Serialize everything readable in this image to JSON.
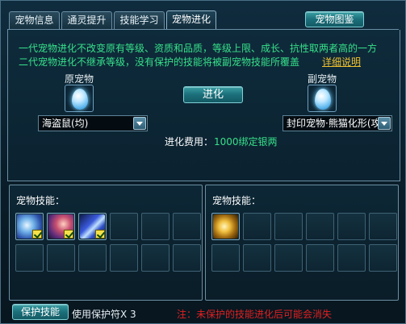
{
  "tabs": [
    {
      "label": "宠物信息",
      "active": false
    },
    {
      "label": "通灵提升",
      "active": false
    },
    {
      "label": "技能学习",
      "active": false
    },
    {
      "label": "宠物进化",
      "active": true
    }
  ],
  "pet_atlas_button": "宠物图鉴",
  "info": {
    "line1": "一代宠物进化不改变原有等级、资质和品质，等级上限、成长、抗性取两者高的一方",
    "line2": "二代宠物进化不继承等级，没有保护的技能将被副宠物技能所覆盖",
    "detail_link": "详细说明"
  },
  "original_pet": {
    "label": "原宠物",
    "icon": "blue-egg-icon",
    "selected": "海盗鼠(均)"
  },
  "secondary_pet": {
    "label": "副宠物",
    "icon": "blue-egg-icon",
    "selected": "封印宠物·熊猫化形(攻)"
  },
  "evolve_button": "进化",
  "cost": {
    "label": "进化费用：",
    "value": "1000绑定银两"
  },
  "left_skills": {
    "title": "宠物技能：",
    "slots": [
      {
        "icon": "wind-swirl-skill-icon",
        "protected": true
      },
      {
        "icon": "fire-dragon-skill-icon",
        "protected": true
      },
      {
        "icon": "blue-slash-skill-icon",
        "protected": true
      },
      {
        "icon": "",
        "protected": false
      },
      {
        "icon": "",
        "protected": false
      },
      {
        "icon": "",
        "protected": false
      },
      {
        "icon": "",
        "protected": false
      },
      {
        "icon": "",
        "protected": false
      },
      {
        "icon": "",
        "protected": false
      },
      {
        "icon": "",
        "protected": false
      },
      {
        "icon": "",
        "protected": false
      },
      {
        "icon": "",
        "protected": false
      }
    ]
  },
  "right_skills": {
    "title": "宠物技能：",
    "slots": [
      {
        "icon": "golden-burst-skill-icon",
        "protected": false
      },
      {
        "icon": "",
        "protected": false
      },
      {
        "icon": "",
        "protected": false
      },
      {
        "icon": "",
        "protected": false
      },
      {
        "icon": "",
        "protected": false
      },
      {
        "icon": "",
        "protected": false
      },
      {
        "icon": "",
        "protected": false
      },
      {
        "icon": "",
        "protected": false
      },
      {
        "icon": "",
        "protected": false
      },
      {
        "icon": "",
        "protected": false
      },
      {
        "icon": "",
        "protected": false
      },
      {
        "icon": "",
        "protected": false
      }
    ]
  },
  "protect_button": "保护技能",
  "protect_status": "使用保护符X 3",
  "warning": "注：未保护的技能进化后可能会消失",
  "colors": {
    "info_text": "#37e08a",
    "link": "#f0c030",
    "warning": "#e02020",
    "check": "#f4e04a"
  }
}
